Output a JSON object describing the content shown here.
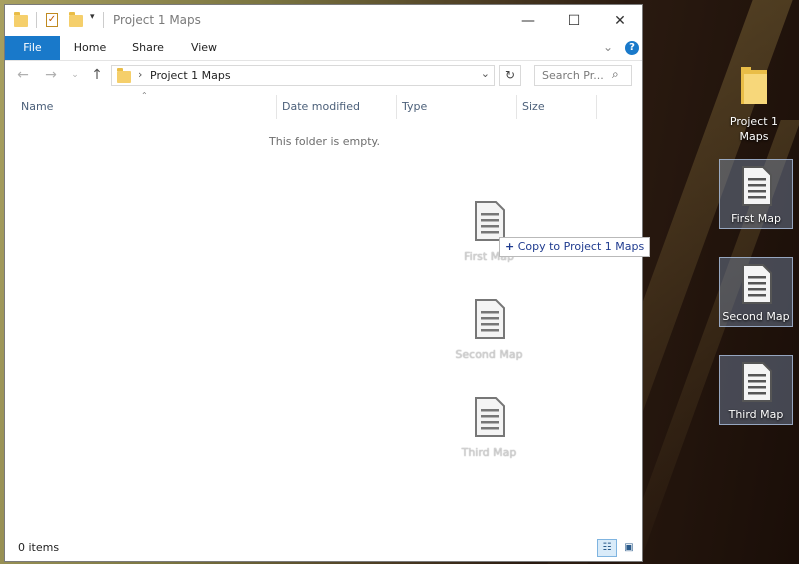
{
  "explorer": {
    "title": "Project 1 Maps",
    "ribbon_tabs": [
      "File",
      "Home",
      "Share",
      "View"
    ],
    "address_path": "Project 1 Maps",
    "search_placeholder": "Search Pr...",
    "columns": [
      "Name",
      "Date modified",
      "Type",
      "Size"
    ],
    "empty_message": "This folder is empty.",
    "status_count": "0 items"
  },
  "drag": {
    "ghost_items": [
      "First Map",
      "Second Map",
      "Third Map"
    ],
    "tooltip_text": "Copy to Project 1 Maps",
    "tooltip_symbol": "+"
  },
  "desktop": {
    "items": [
      {
        "label": "Project 1 Maps",
        "icon": "folder-icon"
      },
      {
        "label": "First Map",
        "icon": "document-icon"
      },
      {
        "label": "Second Map",
        "icon": "document-icon"
      },
      {
        "label": "Third Map",
        "icon": "document-icon"
      }
    ]
  },
  "colors": {
    "accent": "#1979ca",
    "folder": "#f5cf6b",
    "tooltip_text": "#1f3b8f"
  }
}
